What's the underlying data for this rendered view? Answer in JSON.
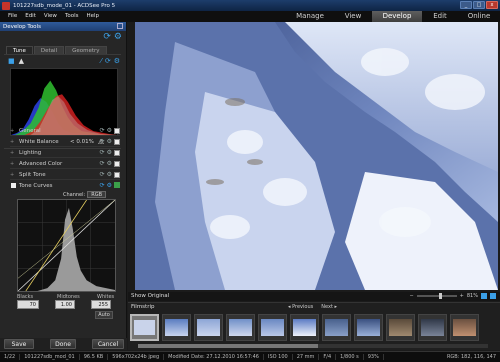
{
  "window": {
    "title": "101227sdb_mode_01 - ACDSee Pro 5"
  },
  "menu": [
    "File",
    "Edit",
    "View",
    "Tools",
    "Help"
  ],
  "modes": [
    {
      "label": "Manage",
      "active": false
    },
    {
      "label": "View",
      "active": false
    },
    {
      "label": "Develop",
      "active": true
    },
    {
      "label": "Edit",
      "active": false
    },
    {
      "label": "Online",
      "active": false
    }
  ],
  "panel": {
    "header": "Develop Tools",
    "tabs": [
      {
        "label": "Tune",
        "active": true
      },
      {
        "label": "Detail",
        "active": false
      },
      {
        "label": "Geometry",
        "active": false
      }
    ],
    "histogram_readout": "< 0.01%",
    "sections": [
      "General",
      "White Balance",
      "Lighting",
      "Advanced Color",
      "Split Tone"
    ],
    "tone_curves": {
      "label": "Tone Curves",
      "channel_label": "Channel:",
      "channel_value": "RGB",
      "blacks_label": "Blacks",
      "midtones_label": "Midtones",
      "whites_label": "Whites",
      "blacks_value": "70",
      "midtones_value": "1.00",
      "whites_value": "255",
      "auto_label": "Auto"
    }
  },
  "buttons": {
    "save": "Save",
    "done": "Done",
    "cancel": "Cancel"
  },
  "viewbar": {
    "show_original": "Show Original",
    "zoom": "81%"
  },
  "filmstrip": {
    "title": "Filmstrip",
    "previous": "Previous",
    "next": "Next"
  },
  "status": {
    "index": "1/22",
    "filename": "101227sdb_mod_01",
    "size": "96.5 KB",
    "dims": "596x702x24b jpeg",
    "modified": "Modified Date: 27.12.2010 16:57:46",
    "iso": "ISO 100",
    "focal": "27 mm",
    "aperture": "F/4",
    "shutter": "1/800 s",
    "zoom": "93%",
    "rgb": "RGB: 182, 116, 147"
  },
  "colors": {
    "accent": "#3ba0e8",
    "active_mode": "#4a4a4a",
    "panel_header": "#2f5a9a"
  }
}
